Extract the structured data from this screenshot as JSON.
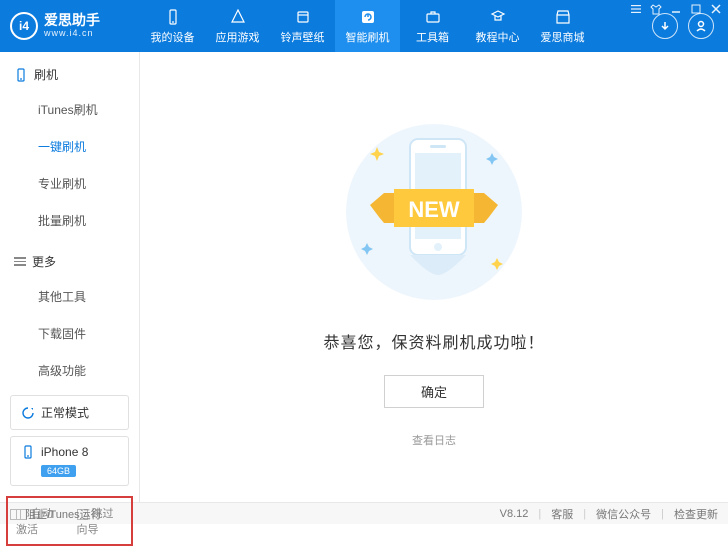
{
  "brand": {
    "name": "爱思助手",
    "url": "www.i4.cn",
    "logo_text": "i4"
  },
  "nav": [
    {
      "label": "我的设备"
    },
    {
      "label": "应用游戏"
    },
    {
      "label": "铃声壁纸"
    },
    {
      "label": "智能刷机"
    },
    {
      "label": "工具箱"
    },
    {
      "label": "教程中心"
    },
    {
      "label": "爱思商城"
    }
  ],
  "sidebar": {
    "flash": {
      "title": "刷机",
      "items": [
        "iTunes刷机",
        "一键刷机",
        "专业刷机",
        "批量刷机"
      ]
    },
    "more": {
      "title": "更多",
      "items": [
        "其他工具",
        "下载固件",
        "高级功能"
      ]
    },
    "mode": "正常模式",
    "device": {
      "name": "iPhone 8",
      "storage": "64GB"
    },
    "checks": [
      "自动激活",
      "跳过向导"
    ]
  },
  "main": {
    "new_text": "NEW",
    "success": "恭喜您，保资料刷机成功啦！",
    "ok": "确定",
    "log": "查看日志"
  },
  "footer": {
    "block_itunes": "阻止iTunes运行",
    "version": "V8.12",
    "support": "客服",
    "wechat": "微信公众号",
    "update": "检查更新"
  }
}
